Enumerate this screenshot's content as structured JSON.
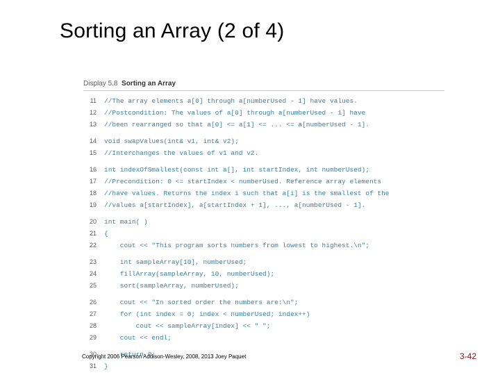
{
  "title": "Sorting an Array (2 of 4)",
  "display": {
    "label": "Display 5.8",
    "caption": "Sorting an Array"
  },
  "lines": {
    "l11": {
      "n": "11",
      "t": "//The array elements a[0] through a[numberUsed - 1] have values."
    },
    "l12": {
      "n": "12",
      "t": "//Postcondition: The values of a[0] through a[numberUsed - 1] have"
    },
    "l13": {
      "n": "13",
      "t": "//been rearranged so that a[0] <= a[1] <= ... <= a[numberUsed - 1]."
    },
    "l14": {
      "n": "14",
      "t": "void swapValues(int& v1, int& v2);"
    },
    "l15": {
      "n": "15",
      "t": "//Interchanges the values of v1 and v2."
    },
    "l16": {
      "n": "16",
      "t": "int indexOfSmallest(const int a[], int startIndex, int numberUsed);"
    },
    "l17": {
      "n": "17",
      "t": "//Precondition: 0 <= startIndex < numberUsed. Reference array elements"
    },
    "l18": {
      "n": "18",
      "t": "//have values. Returns the index i such that a[i] is the smallest of the"
    },
    "l19": {
      "n": "19",
      "t": "//values a[startIndex], a[startIndex + 1], ..., a[numberUsed - 1]."
    },
    "l20": {
      "n": "20",
      "t": "int main( )"
    },
    "l21": {
      "n": "21",
      "t": "{"
    },
    "l22": {
      "n": "22",
      "t": "    cout << \"This program sorts numbers from lowest to highest.\\n\";"
    },
    "l23": {
      "n": "23",
      "t": "    int sampleArray[10], numberUsed;"
    },
    "l24": {
      "n": "24",
      "t": "    fillArray(sampleArray, 10, numberUsed);"
    },
    "l25": {
      "n": "25",
      "t": "    sort(sampleArray, numberUsed);"
    },
    "l26": {
      "n": "26",
      "t": "    cout << \"In sorted order the numbers are:\\n\";"
    },
    "l27": {
      "n": "27",
      "t": "    for (int index = 0; index < numberUsed; index++)"
    },
    "l28": {
      "n": "28",
      "t": "        cout << sampleArray[index] << \" \";"
    },
    "l29": {
      "n": "29",
      "t": "    cout << endl;"
    },
    "l30": {
      "n": "30",
      "t": "    return 0;"
    },
    "l31": {
      "n": "31",
      "t": "}"
    }
  },
  "copyright": "Copyright  2006 Pearson Addison-Wesley, 2008, 2013 Joey Paquet",
  "pagenum": "3-42"
}
